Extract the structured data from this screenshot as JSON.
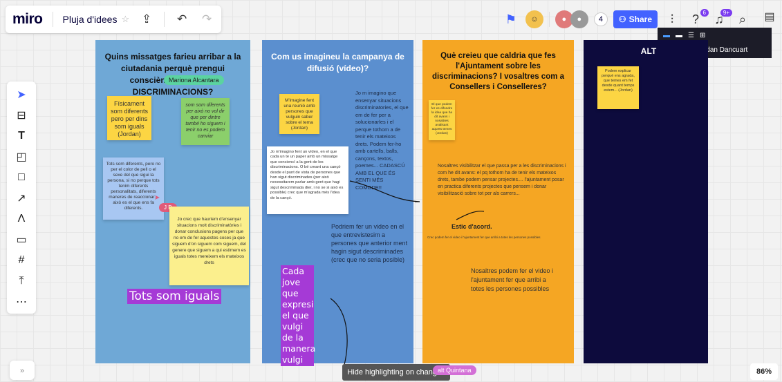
{
  "app": {
    "logo": "miro",
    "board_title": "Pluja d'idees",
    "zoom": "86%"
  },
  "topbar": {
    "share_label": "Share",
    "collab_count": "4",
    "notif_badge": "9+",
    "help_badge": "6"
  },
  "tooltip": {
    "text": "Hablando: Jordan Dancuart"
  },
  "bottom_tip": {
    "text": "Hide highlighting on changes"
  },
  "cursors": {
    "mariona": "Mariona Alcantara",
    "jd": "J D",
    "quintana": "alt Quintana"
  },
  "columns": {
    "c1": {
      "title": "Quins missatges farieu arribar a la ciutadania perquè prengui consciència sobre les DISCRIMINACIONS?",
      "n1": "Físicament som diferents pero per dins som iguals (Jordan)",
      "n2": "som som diferents per això no vol dir que per dintre també ho siguem i tenir no es podem canviar",
      "n3": "Tots som diferents, pero no per el color de pell o el sexe del que sigui la persona, si no perque tots tenim diferents personalitats, diferents maneres de reaccionar... això es el que ens fa diferents.",
      "n4": "Jo crec que hauriem d'ensenyar situacions molt discriminatòries i donar conclusions pagens per que no em de fer aquestes coses ja que siguem d'on siguem com siguem, del genere que siguem a qui estimem es iguals totes mereixem els mateixos drets",
      "label": "Tots som iguals"
    },
    "c2": {
      "title": "Com us imagineu la campanya de difusió (vídeo)?",
      "n1": "M'imagine fent una reunió amb persones que vulguin saber sobre el tema (Jordan)",
      "t1": "Jo m imagino que ensenyar situacions discriminatories, el que em de fer per a solucionarles i el perque tothom a de tenir els mateixos drets. Podem fer-ho amb cartells, balls, cançons, textos, poemes... CADASCÚ AMB EL QUE ÉS SENTI MÉS COMODE!!",
      "n2": "Jo m'imagino fent un vídeo, en el que cada un te un paper amb un missatge que conciencï a la gent de les discriminacions. O bé creant una cançó desde el punt de vista de persones que han sigut discriminades (per això necessitarem parlar amb gent que hagi sigut descriminada dier, i no se si això es possible) crec que m'agrada més l'idea de la cançó.",
      "t2": "Podriem fer un video en el que entrevistesim a persones que anterior ment hagin sigut descriminades (crec que no seria posible)",
      "label": "Cada jove que expresi el que vulgi de la manera vulgi"
    },
    "c3": {
      "title": "Què creieu que caldria que fes l'Ajuntament sobre les discriminacions? I vosaltres com a Consellers i Conselleres?",
      "n1": "El que podem fer es difondre la idea que ha dit avans i nosaltres avalisant aquets temes (Jordan)",
      "t1": "Nosaltres visibilitzar el que passa per a les discriminacions i com he dit avans: el pq tothom ha de tenir els mateixos drets, tambe podem pensar projectes.... l'ajuntament posar en practica diferents projectes que pensem i donar visibilització sobre tot per als carrers...",
      "t2": "Estic d'acord.",
      "t3": "Crec podem fer el video i l'ajuntament fer que arribi a totes les persones possibles",
      "t4": "Nosaltres podem fer el video i l'ajuntament fer que arribi a totes les persones possibles"
    },
    "c4": {
      "title": "ALT",
      "n1": "Podem explicar perquè ens agrada, que temes em fet desde quant temps estem... (Jordan)"
    }
  }
}
